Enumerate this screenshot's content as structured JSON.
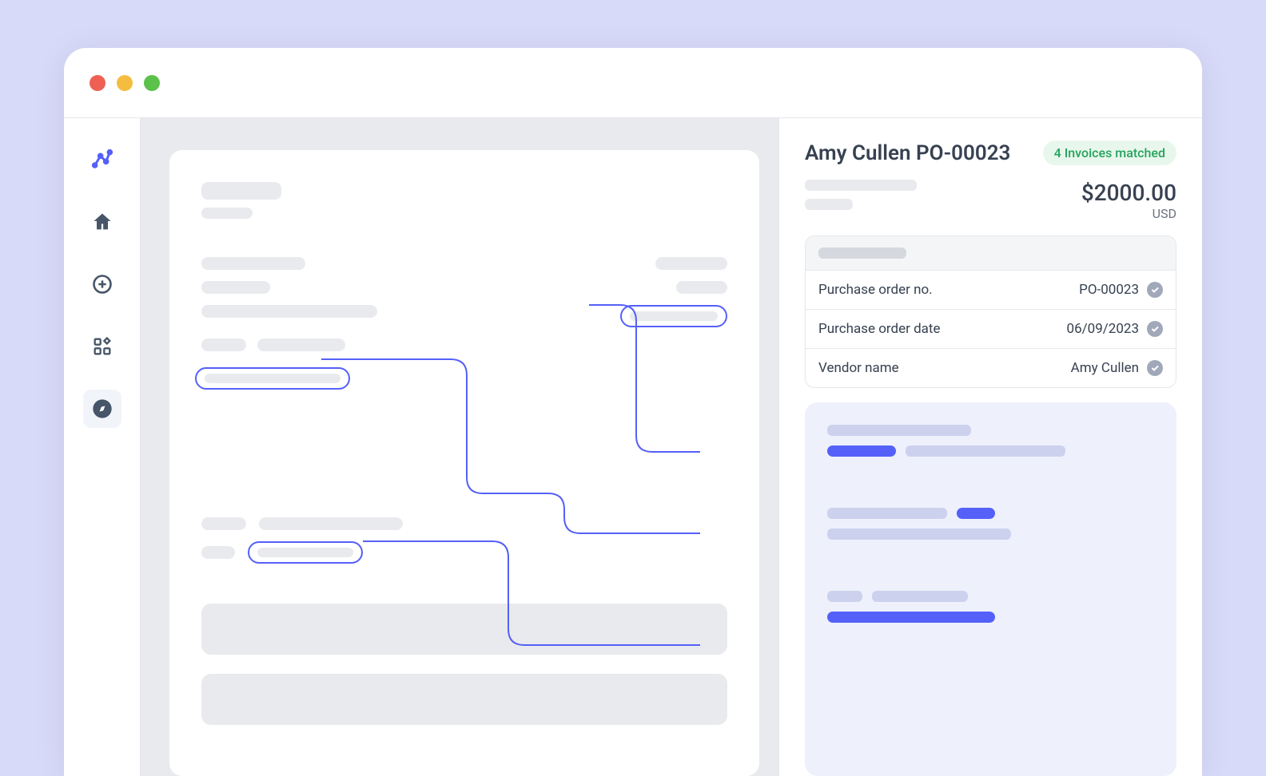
{
  "details": {
    "title": "Amy Cullen PO-00023",
    "badge": "4 Invoices matched",
    "amount": "$2000.00",
    "currency": "USD",
    "fields": [
      {
        "label": "Purchase order no.",
        "value": "PO-00023"
      },
      {
        "label": "Purchase order date",
        "value": "06/09/2023"
      },
      {
        "label": "Vendor name",
        "value": "Amy Cullen"
      }
    ]
  },
  "colors": {
    "accent": "#5460f8",
    "success": "#27a35e"
  }
}
